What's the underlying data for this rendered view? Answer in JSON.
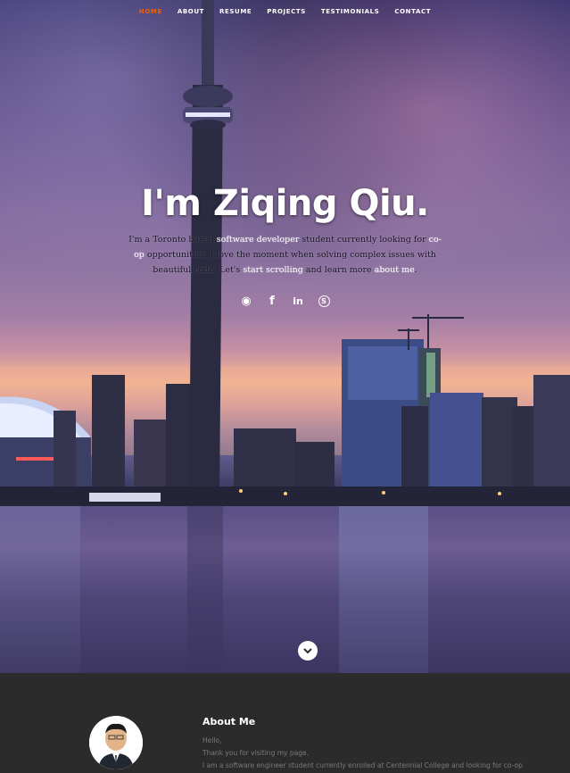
{
  "nav": {
    "items": [
      "HOME",
      "ABOUT",
      "RESUME",
      "PROJECTS",
      "TESTIMONIALS",
      "CONTACT"
    ],
    "active": "HOME"
  },
  "banner": {
    "headline": "I'm Ziqing Qiu.",
    "intro": {
      "t1": "I'm a Toronto based ",
      "h1": "software developer",
      "t2": " student currently looking for ",
      "h2": "co-op",
      "t3": " opportunities. I love the moment when solving complex issues with beautiful code. Let's ",
      "h3": "start scrolling",
      "t4": " and learn more ",
      "h4": "about me",
      "t5": "."
    },
    "social_icons": [
      "github-icon",
      "facebook-icon",
      "linkedin-icon",
      "skype-icon"
    ],
    "social_glyphs": {
      "github": "◉",
      "facebook": "f",
      "linkedin": "in",
      "skype": "S"
    }
  },
  "about": {
    "title": "About Me",
    "lines": [
      "Hello,",
      "Thank you for visiting my page.",
      "I am a software engineer student currently enrolled at Centennial College and looking for co-op"
    ]
  },
  "colors": {
    "nav_active": "#f06000",
    "about_bg": "#2b2b2b",
    "about_text": "#7a7a7a"
  }
}
